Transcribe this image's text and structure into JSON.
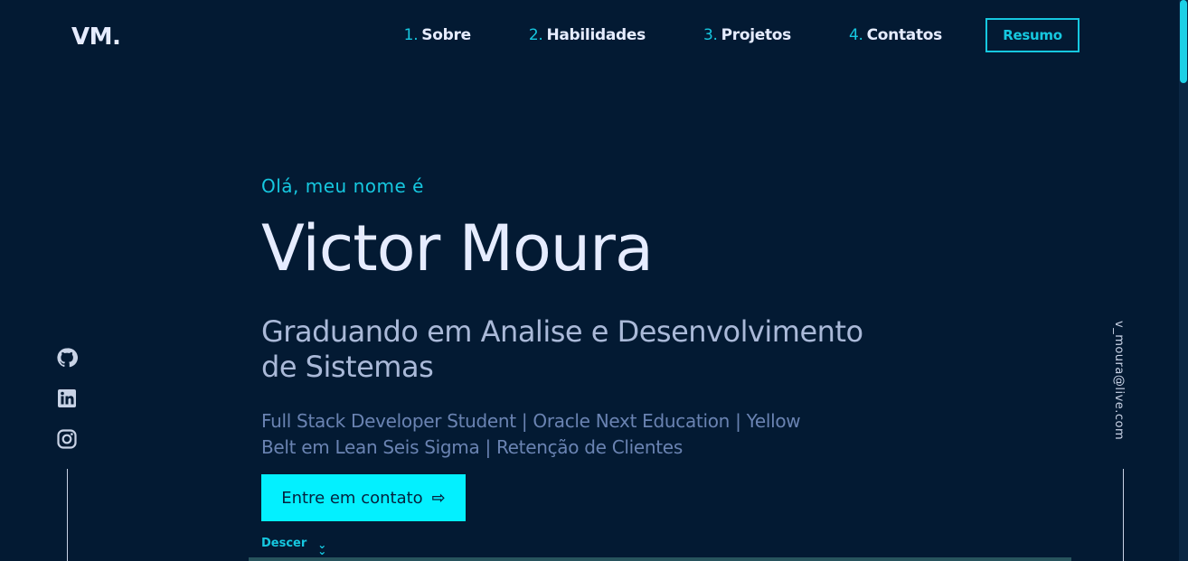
{
  "brand": {
    "logo": "VM."
  },
  "nav": {
    "items": [
      {
        "num": "1.",
        "label": "Sobre"
      },
      {
        "num": "2.",
        "label": "Habilidades"
      },
      {
        "num": "3.",
        "label": "Projetos"
      },
      {
        "num": "4.",
        "label": "Contatos"
      }
    ],
    "resume_label": "Resumo"
  },
  "hero": {
    "greeting": "Olá, meu nome é",
    "name": "Victor Moura",
    "subtitle": "Graduando em Analise e Desenvolvimento de Sistemas",
    "description": "Full Stack Developer Student | Oracle Next Education | Yellow Belt em Lean Seis Sigma | Retenção de Clientes",
    "cta_label": "Entre em contato",
    "cta_icon": "arrow-right-icon",
    "scroll_label": "Descer",
    "scroll_icon": "double-chevron-down-icon"
  },
  "social": {
    "icons": [
      "github-icon",
      "linkedin-icon",
      "instagram-icon"
    ]
  },
  "email": "v_moura@live.com",
  "colors": {
    "background": "#031a33",
    "accent": "#16c8e0",
    "cta_background": "#03f0ff",
    "heading": "#e6ecff",
    "subtitle": "#aab9d8",
    "description": "#6a83b2"
  }
}
